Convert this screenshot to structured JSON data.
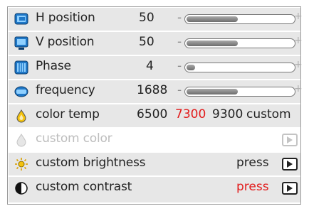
{
  "rows": [
    {
      "icon": "h-position-icon",
      "label": "H position",
      "value": "50",
      "slider_minus": "-",
      "slider_plus": "+",
      "level": 0.5
    },
    {
      "icon": "v-position-icon",
      "label": "V position",
      "value": "50",
      "slider_minus": "-",
      "slider_plus": "+",
      "level": 0.5
    },
    {
      "icon": "phase-icon",
      "label": "Phase",
      "value": "4",
      "slider_minus": "-",
      "slider_plus": "+",
      "level": 0.08
    },
    {
      "icon": "frequency-icon",
      "label": "frequency",
      "value": "1688",
      "slider_minus": "-",
      "slider_plus": "+",
      "level": 0.5
    }
  ],
  "color_temp": {
    "icon": "color-temp-icon",
    "label": "color temp",
    "options": [
      "6500",
      "7300",
      "9300",
      "custom"
    ],
    "selected": "7300"
  },
  "custom_color": {
    "icon": "custom-color-icon",
    "label": "custom color",
    "disabled": true
  },
  "custom_brightness": {
    "icon": "brightness-icon",
    "label": "custom brightness",
    "action": "press"
  },
  "custom_contrast": {
    "icon": "contrast-icon",
    "label": "custom contrast",
    "action": "press"
  },
  "colors": {
    "accent_red": "#e21b1b",
    "icon_blue": "#1f78c8",
    "row_grey": "#e7e7e7"
  }
}
